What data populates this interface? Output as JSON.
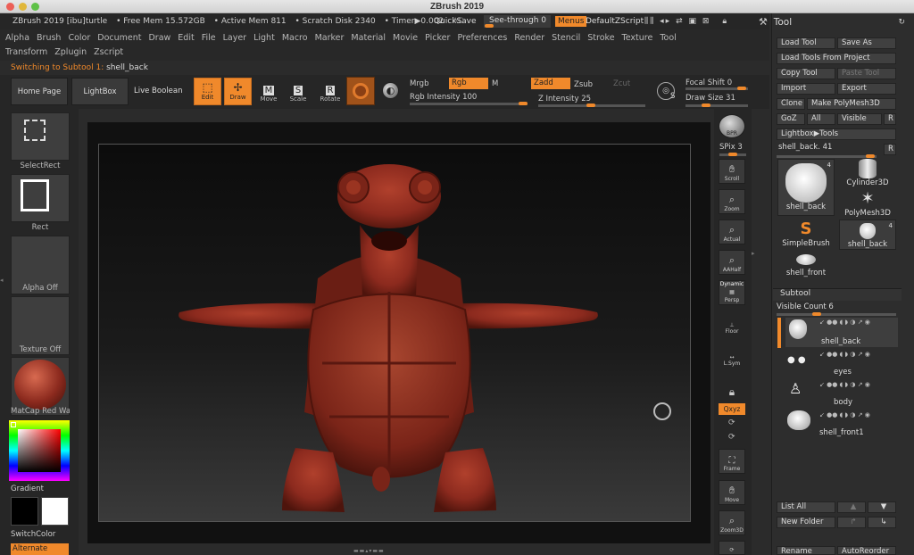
{
  "window": {
    "title": "ZBrush 2019"
  },
  "status": {
    "app": "ZBrush 2019 [ibu]turtle",
    "free_mem": "• Free Mem 15.572GB",
    "active_mem": "• Active Mem 811",
    "scratch": "• Scratch Disk 2340",
    "timer": "• Timer▶0.002",
    "ac": "AC",
    "quicksave": "QuickSave",
    "seethrough": "See-through",
    "seethrough_val": "0",
    "menus": "Menus",
    "default_zscript": "DefaultZScript"
  },
  "menus": [
    "Alpha",
    "Brush",
    "Color",
    "Document",
    "Draw",
    "Edit",
    "File",
    "Layer",
    "Light",
    "Macro",
    "Marker",
    "Material",
    "Movie",
    "Picker",
    "Preferences",
    "Render",
    "Stencil",
    "Stroke",
    "Texture",
    "Tool",
    "Transform",
    "Zplugin",
    "Zscript"
  ],
  "subtool_msg": {
    "prefix": "Switching to Subtool 1:",
    "name": "shell_back"
  },
  "topbar": {
    "home": "Home Page",
    "lightbox": "LightBox",
    "live_boolean": "Live Boolean",
    "edit": "Edit",
    "draw": "Draw",
    "move": "Move",
    "scale": "Scale",
    "rotate": "Rotate",
    "mrgb": "Mrgb",
    "rgb": "Rgb",
    "m": "M",
    "zadd": "Zadd",
    "zsub": "Zsub",
    "zcut": "Zcut",
    "rgb_intensity": "Rgb Intensity 100",
    "z_intensity": "Z Intensity 25",
    "focal_shift": "Focal Shift 0",
    "draw_size": "Draw Size 31",
    "s_label": "S"
  },
  "leftshelf": {
    "select_rect": "SelectRect",
    "rect": "Rect",
    "alpha": "Alpha Off",
    "texture": "Texture Off",
    "matcap": "MatCap Red Wa",
    "gradient": "Gradient",
    "switch_color": "SwitchColor",
    "alternate": "Alternate"
  },
  "rightshelf": {
    "bpr": "BPR",
    "spix": "SPix 3",
    "scroll": "Scroll",
    "zoom": "Zoom",
    "actual": "Actual",
    "aahalf": "AAHalf",
    "dynamic": "Dynamic",
    "persp": "Persp",
    "floor": "Floor",
    "lsym": "L.Sym",
    "xyz": "Qxyz",
    "frame": "Frame",
    "move": "Move",
    "zoom3d": "Zoom3D"
  },
  "toolpanel": {
    "title": "Tool",
    "load_tool": "Load Tool",
    "save_as": "Save As",
    "load_from_project": "Load Tools From Project",
    "copy_tool": "Copy Tool",
    "paste_tool": "Paste Tool",
    "import": "Import",
    "export": "Export",
    "clone": "Clone",
    "make_polymesh": "Make PolyMesh3D",
    "goz": "GoZ",
    "all": "All",
    "visible": "Visible",
    "r": "R",
    "lightbox_tools": "Lightbox▶Tools",
    "current_tool": "shell_back. 41",
    "tools": [
      {
        "name": "shell_back",
        "count": "4"
      },
      {
        "name": "Cylinder3D",
        "count": ""
      },
      {
        "name": "PolyMesh3D",
        "count": ""
      },
      {
        "name": "SimpleBrush",
        "count": ""
      },
      {
        "name": "shell_back",
        "count": "4"
      },
      {
        "name": "shell_front",
        "count": ""
      }
    ]
  },
  "subtool": {
    "title": "Subtool",
    "visible_count": "Visible Count 6",
    "items": [
      "shell_back",
      "eyes",
      "body",
      "shell_front1"
    ],
    "list_all": "List All",
    "new_folder": "New Folder",
    "rename": "Rename",
    "auto_reorder": "AutoReorder"
  },
  "colors": {
    "accent": "#f0892b",
    "model": "#8c2a1e"
  }
}
